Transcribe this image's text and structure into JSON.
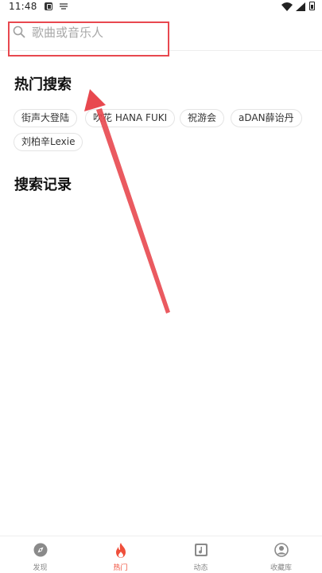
{
  "status_bar": {
    "time": "11:48"
  },
  "search": {
    "placeholder": "歌曲或音乐人"
  },
  "hot": {
    "title": "热门搜索",
    "tags": [
      "街声大登陆",
      "吹花 HANA FUKI",
      "祝游会",
      "aDAN薛诒丹",
      "刘柏辛Lexie"
    ]
  },
  "history": {
    "title": "搜索记录"
  },
  "tab_bar": {
    "tabs": [
      {
        "label": "发现",
        "icon": "compass-icon"
      },
      {
        "label": "热门",
        "icon": "flame-icon"
      },
      {
        "label": "动态",
        "icon": "music-card-icon"
      },
      {
        "label": "收藏库",
        "icon": "user-icon"
      }
    ],
    "active_index": 1
  },
  "colors": {
    "accent": "#ef4f3b",
    "annotation": "#e8484f"
  }
}
